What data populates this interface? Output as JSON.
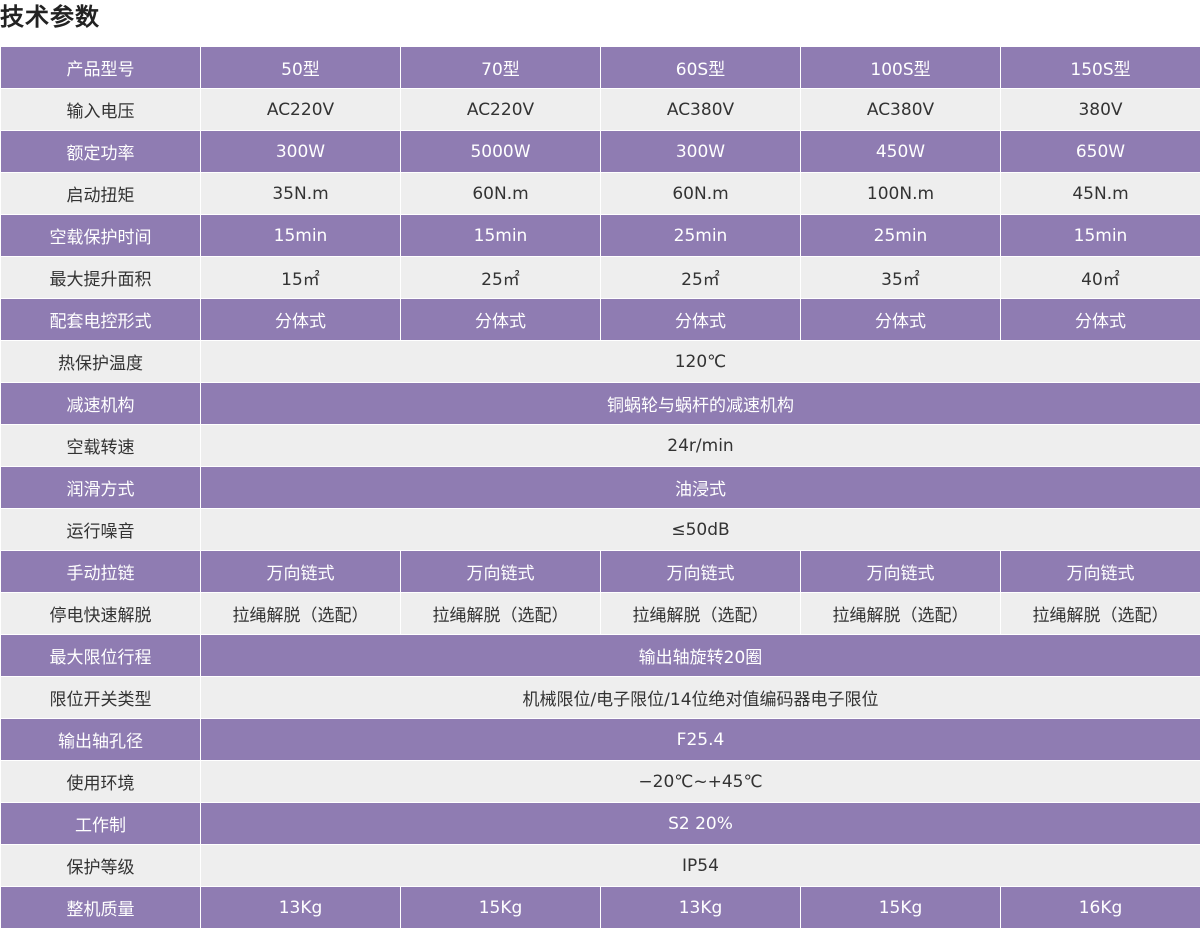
{
  "title": "技术参数",
  "rows": [
    {
      "label": "产品型号",
      "values": [
        "50型",
        "70型",
        "60S型",
        "100S型",
        "150S型"
      ]
    },
    {
      "label": "输入电压",
      "values": [
        "AC220V",
        "AC220V",
        "AC380V",
        "AC380V",
        "380V"
      ]
    },
    {
      "label": "额定功率",
      "values": [
        "300W",
        "5000W",
        "300W",
        "450W",
        "650W"
      ]
    },
    {
      "label": "启动扭矩",
      "values": [
        "35N.m",
        "60N.m",
        "60N.m",
        "100N.m",
        "45N.m"
      ]
    },
    {
      "label": "空载保护时间",
      "values": [
        "15min",
        "15min",
        "25min",
        "25min",
        "15min"
      ]
    },
    {
      "label": "最大提升面积",
      "values": [
        "15㎡",
        "25㎡",
        "25㎡",
        "35㎡",
        "40㎡"
      ]
    },
    {
      "label": "配套电控形式",
      "values": [
        "分体式",
        "分体式",
        "分体式",
        "分体式",
        "分体式"
      ]
    },
    {
      "label": "热保护温度",
      "value": "120℃"
    },
    {
      "label": "减速机构",
      "value": "铜蜗轮与蜗杆的减速机构"
    },
    {
      "label": "空载转速",
      "value": "24r/min"
    },
    {
      "label": "润滑方式",
      "value": "油浸式"
    },
    {
      "label": "运行噪音",
      "value": "≤50dB"
    },
    {
      "label": "手动拉链",
      "values": [
        "万向链式",
        "万向链式",
        "万向链式",
        "万向链式",
        "万向链式"
      ]
    },
    {
      "label": "停电快速解脱",
      "values": [
        "拉绳解脱（选配）",
        "拉绳解脱（选配）",
        "拉绳解脱（选配）",
        "拉绳解脱（选配）",
        "拉绳解脱（选配）"
      ]
    },
    {
      "label": "最大限位行程",
      "value": "输出轴旋转20圈"
    },
    {
      "label": "限位开关类型",
      "value": "机械限位/电子限位/14位绝对值编码器电子限位"
    },
    {
      "label": "输出轴孔径",
      "value": "F25.4"
    },
    {
      "label": "使用环境",
      "value": "−20℃~+45℃"
    },
    {
      "label": "工作制",
      "value": "S2 20%"
    },
    {
      "label": "保护等级",
      "value": "IP54"
    },
    {
      "label": "整机质量",
      "values": [
        "13Kg",
        "15Kg",
        "13Kg",
        "15Kg",
        "16Kg"
      ]
    }
  ]
}
